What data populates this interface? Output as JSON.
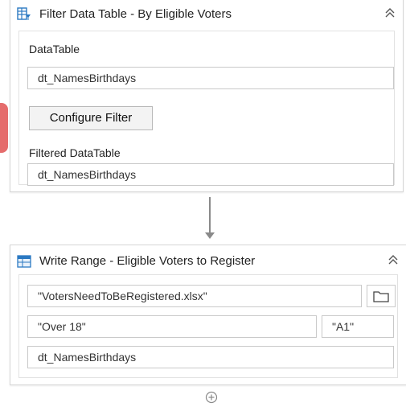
{
  "filter_activity": {
    "title": "Filter Data Table - By Eligible Voters",
    "datatable_label": "DataTable",
    "datatable_value": "dt_NamesBirthdays",
    "configure_button": "Configure Filter",
    "filtered_label": "Filtered DataTable",
    "filtered_value": "dt_NamesBirthdays",
    "icon": "table-filter-icon"
  },
  "write_activity": {
    "title": "Write Range - Eligible Voters to Register",
    "workbook_path": "\"VotersNeedToBeRegistered.xlsx\"",
    "sheet_name": "\"Over 18\"",
    "start_cell": "\"A1\"",
    "datatable_value": "dt_NamesBirthdays",
    "icon": "write-range-icon"
  },
  "icons": {
    "collapse": "double-chevron-up-icon",
    "folder": "folder-icon",
    "add": "plus-circle-icon",
    "connector": "arrow-down-icon"
  },
  "colors": {
    "accent": "#2b79c2",
    "border": "#d6d6d6",
    "connector": "#8a8a8a",
    "marker": "#e25c5c"
  }
}
